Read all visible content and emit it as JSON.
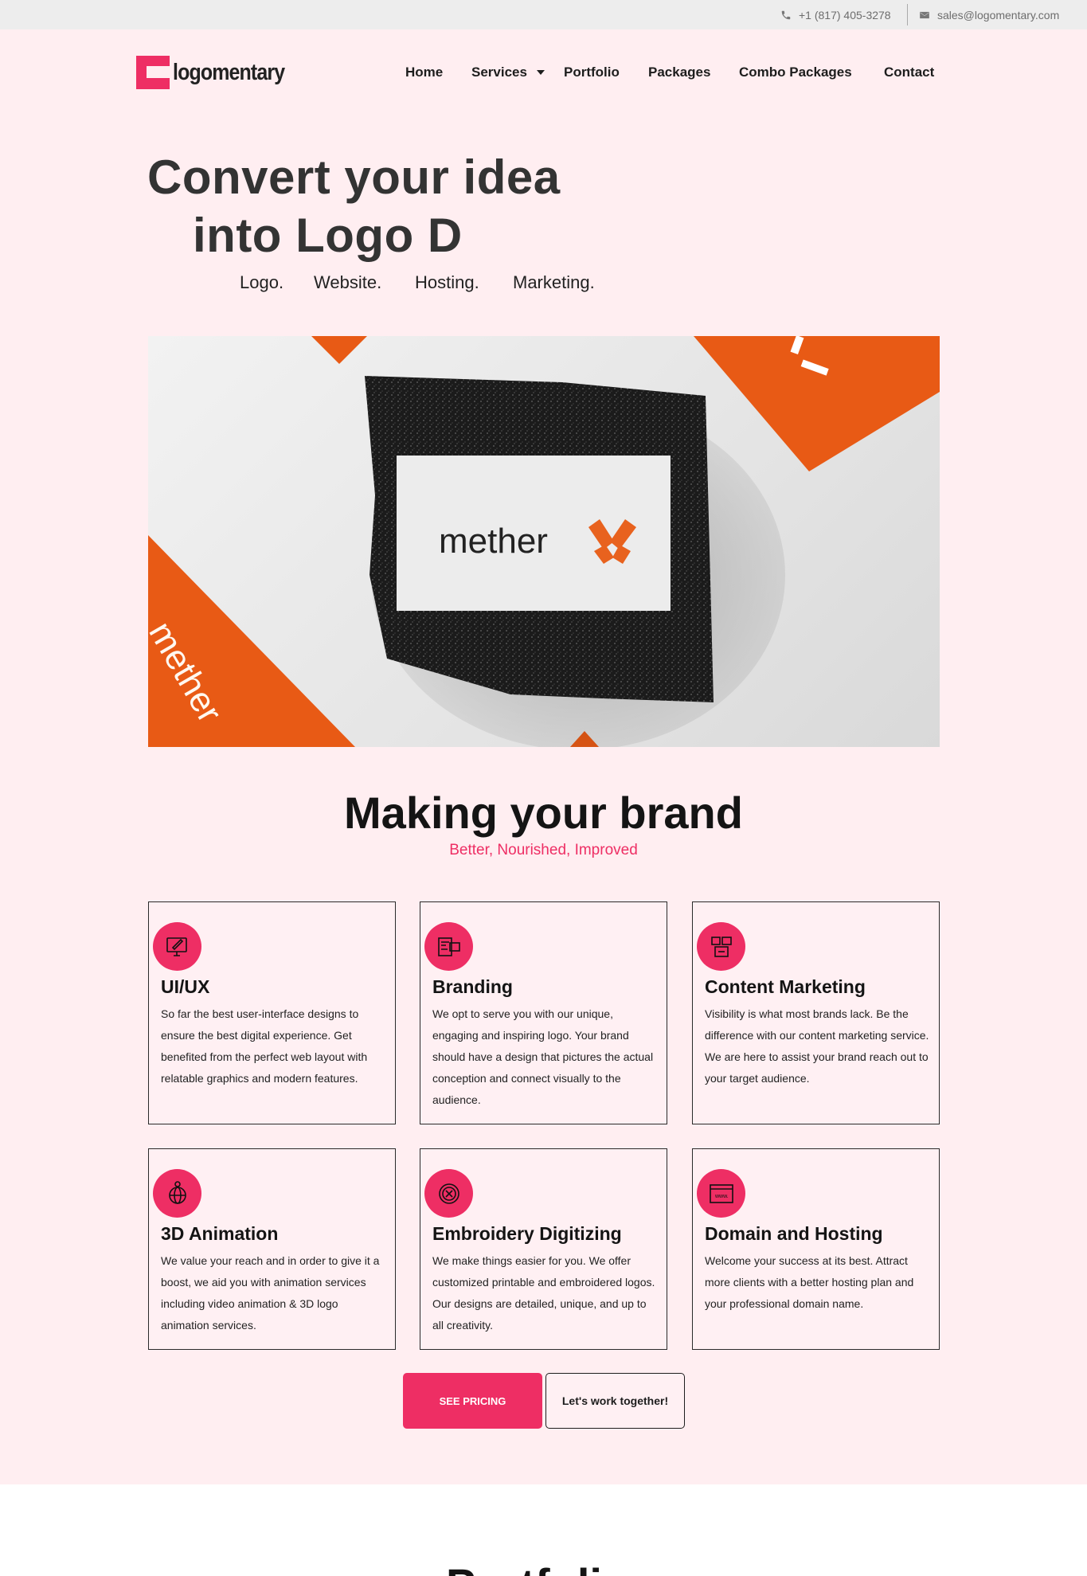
{
  "topbar": {
    "phone": "+1 (817) 405-3278",
    "email": "sales@logomentary.com",
    "phone_icon": "phone-icon",
    "email_icon": "envelope-icon"
  },
  "brand": {
    "name": "logomentary",
    "accent_color": "#ee2e64",
    "background_color": "#ffeef1"
  },
  "nav": {
    "items": [
      "Home",
      "Services",
      "Portfolio",
      "Packages",
      "Combo Packages",
      "Contact"
    ]
  },
  "hero": {
    "line1": "Convert your idea",
    "line2": "into Logo D",
    "tags": [
      "Logo.",
      "Website.",
      "Hosting.",
      "Marketing."
    ]
  },
  "hero_image": {
    "card_text": "mether",
    "side_text": "mether",
    "icon": "mether-logo-icon"
  },
  "section": {
    "title": "Making your brand",
    "subtitle": "Better, Nourished, Improved"
  },
  "services": [
    {
      "title": "UI/UX",
      "icon": "design-monitor-icon",
      "text": "So far the best user-interface designs to ensure the best digital experience. Get benefited from the perfect web layout with relatable graphics and modern features."
    },
    {
      "title": "Branding",
      "icon": "branding-icon",
      "text": "We opt to serve you with our unique, engaging and inspiring logo. Your brand should have a design that pictures the actual conception and connect visually to the audience."
    },
    {
      "title": "Content Marketing",
      "icon": "content-marketing-icon",
      "text": "Visibility is what most brands lack. Be the difference with our content marketing service. We are here to assist your brand reach out to your target audience."
    },
    {
      "title": "3D Animation",
      "icon": "3d-globe-icon",
      "text": "We value your reach and in order to give it a boost, we aid you with animation services including video animation & 3D logo animation services."
    },
    {
      "title": "Embroidery Digitizing",
      "icon": "embroidery-icon",
      "text": "We make things easier for you. We offer customized printable and embroidered logos. Our designs are detailed, unique, and up to all creativity."
    },
    {
      "title": "Domain and Hosting",
      "icon": "www-browser-icon",
      "text": "Welcome your success at its best. Attract more clients with a better hosting plan and your professional domain name."
    }
  ],
  "buttons": {
    "pricing": "SEE PRICING",
    "work": "Let's work together!"
  },
  "portfolio": {
    "title": "Portfolio"
  }
}
